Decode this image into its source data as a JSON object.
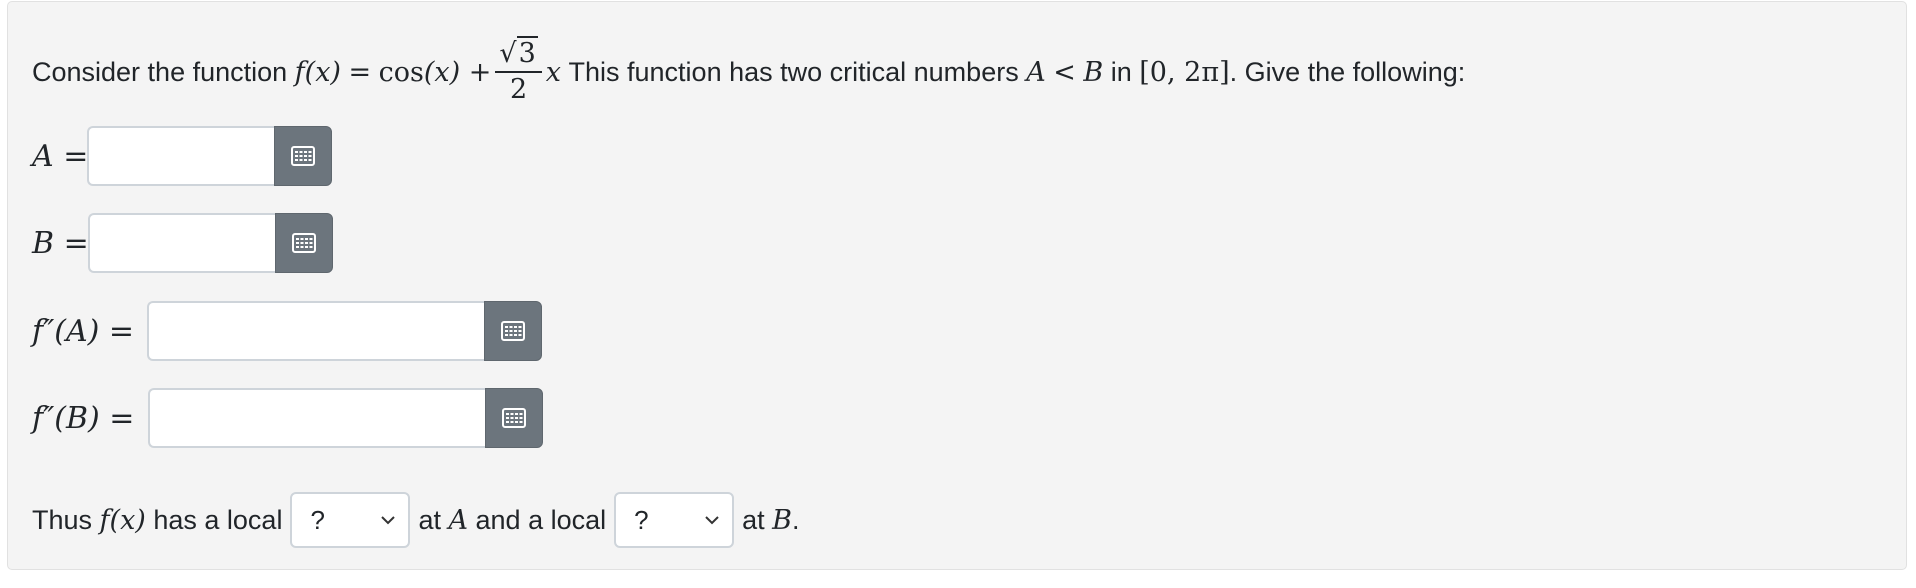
{
  "question": {
    "intro": "Consider the function",
    "func_lhs": "f(x)",
    "eq": "=",
    "cos": "cos",
    "cos_arg": "(x) +",
    "frac_sqrt": "3",
    "frac_den": "2",
    "var_x": "x",
    "middle": "This function has two critical numbers",
    "A": "A",
    "lt": "<",
    "B": "B",
    "in": "in",
    "interval": "[0, 2π]",
    "end": ". Give the following:"
  },
  "answers": [
    {
      "label": "A =",
      "value": ""
    },
    {
      "label": "B =",
      "value": ""
    },
    {
      "label": "f″(A) =",
      "value": ""
    },
    {
      "label": "f″(B) =",
      "value": ""
    }
  ],
  "final": {
    "thus": "Thus",
    "fx": "f(x)",
    "has_local": "has a local",
    "select1_value": "?",
    "at": "at",
    "A": "A",
    "and_local": "and a local",
    "select2_value": "?",
    "at2": "at",
    "B": "B",
    "period": "."
  },
  "icons": {
    "keyboard": "keyboard-icon",
    "chevron": "chevron-down-icon"
  },
  "colors": {
    "panel_bg": "#f4f4f4",
    "button_bg": "#6c757d"
  }
}
